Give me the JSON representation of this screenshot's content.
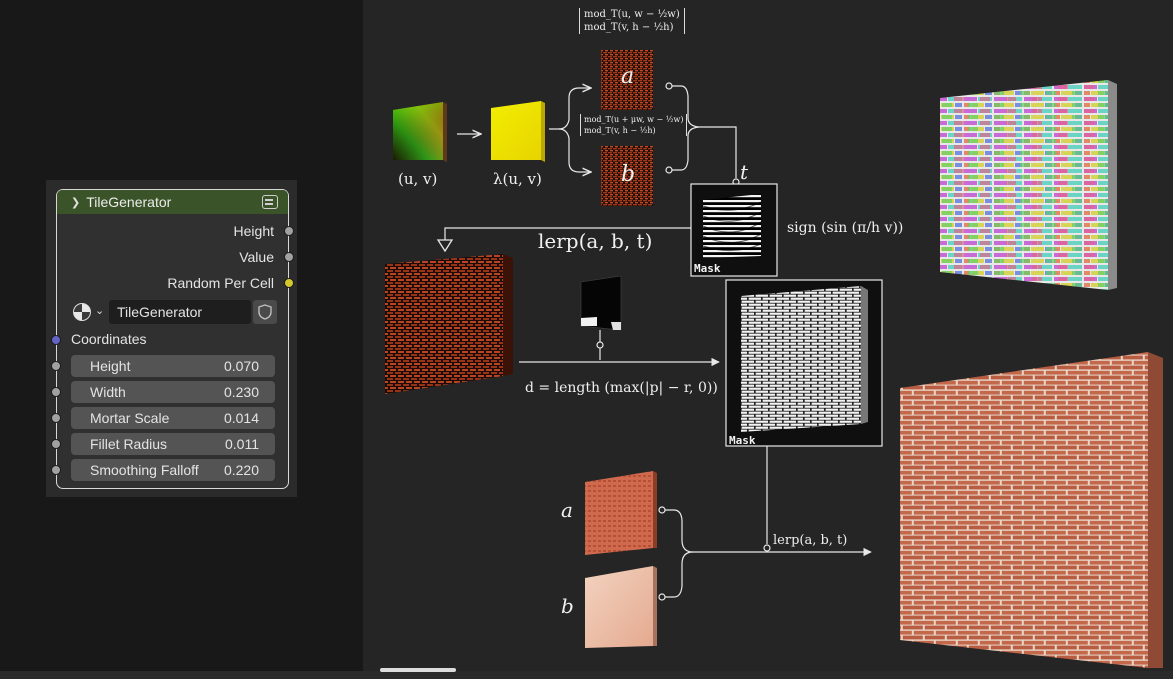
{
  "node": {
    "title": "TileGenerator",
    "outputs": [
      "Height",
      "Value",
      "Random Per Cell"
    ],
    "selector_value": "TileGenerator",
    "input_label": "Coordinates",
    "params": [
      {
        "name": "Height",
        "value": "0.070"
      },
      {
        "name": "Width",
        "value": "0.230"
      },
      {
        "name": "Mortar Scale",
        "value": "0.014"
      },
      {
        "name": "Fillet Radius",
        "value": "0.011"
      },
      {
        "name": "Smoothing Falloff",
        "value": "0.220"
      }
    ]
  },
  "diagram": {
    "uv_label": "(u, v)",
    "lambda_label": "λ(u, v)",
    "top_matrix": [
      "mod_T(u, w − ½w)",
      "mod_T(v, h − ½h)"
    ],
    "mid_matrix": [
      "mod_T(u + μw, w − ½w)",
      "mod_T(v, h − ½h)"
    ],
    "a_label": "a",
    "b_label": "b",
    "t_label": "t",
    "lerp1": "lerp(a, b, t)",
    "sign_formula": "sign (sin (π/h v))",
    "mask_label_1": "Mask",
    "mask_label_2": "Mask",
    "distance_formula": "d = length (max(|p| − r, 0))",
    "lerp2": "lerp(a, b, t)",
    "a2_label": "a",
    "b2_label": "b"
  },
  "colors": {
    "node_header": "#3b5328",
    "socket_grey": "#a1a1a1",
    "socket_yellow": "#d4c92a",
    "socket_purple": "#6363c7",
    "brick": "#c4684c"
  }
}
